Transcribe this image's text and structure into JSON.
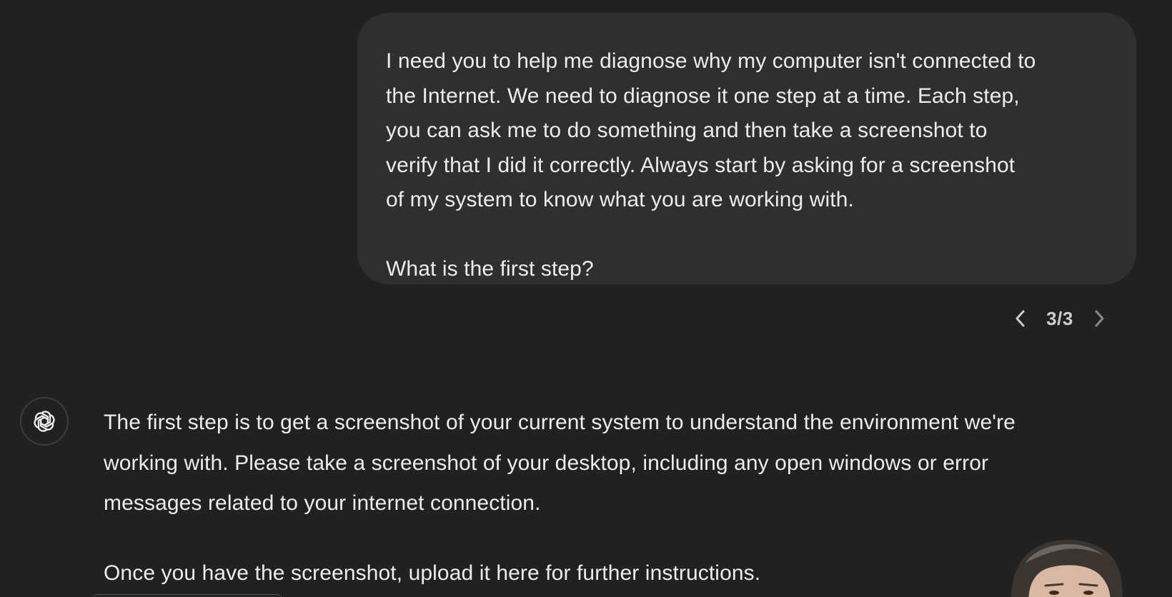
{
  "conversation": {
    "user_message": {
      "paragraphs": [
        [
          "I need you to help me diagnose why my computer isn't connected to",
          "the Internet. We need to diagnose it one step at a time. Each step,",
          "you can ask me to do something and then take a screenshot to",
          "verify that I did it correctly. Always start by asking for a screenshot",
          "of my system to know what you are working with."
        ],
        [
          "What is the first step?"
        ]
      ]
    },
    "pager": {
      "count": "3/3",
      "prev_icon": "chevron-left-icon",
      "next_icon": "chevron-right-icon"
    },
    "assistant_message": {
      "avatar_icon": "chatgpt-logo-icon",
      "paragraphs": [
        [
          "The first step is to get a screenshot of your current system to understand the environment we're",
          "working with. Please take a screenshot of your desktop, including any open windows or error",
          "messages related to your internet connection."
        ],
        [
          "Once you have the screenshot, upload it here for further instructions."
        ]
      ]
    }
  },
  "colors": {
    "background": "#212121",
    "user_bubble": "#2f2f2f",
    "text": "#ececec"
  }
}
